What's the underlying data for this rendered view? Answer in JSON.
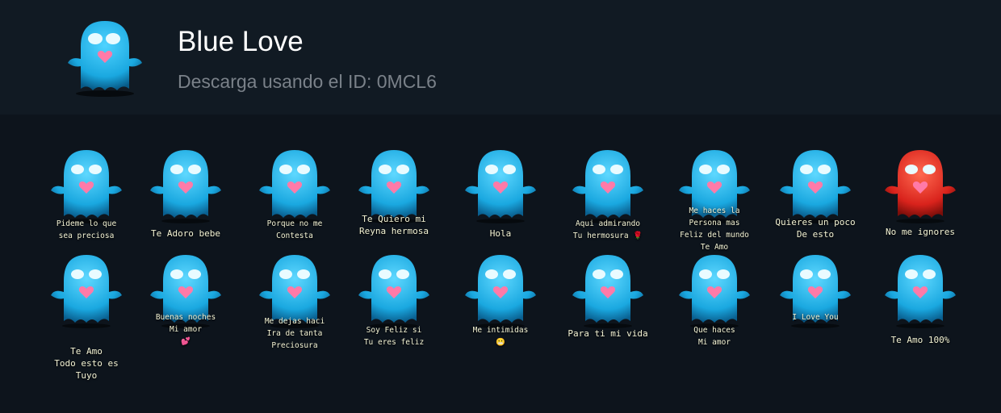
{
  "pack": {
    "title": "Blue Love",
    "subtitle": "Descarga usando el ID: 0MCL6"
  },
  "stickers": [
    {
      "caption": "Pideme lo que\nsea preciosa"
    },
    {
      "caption": "Te Adoro bebe"
    },
    {
      "caption": "Porque no me\nContesta"
    },
    {
      "caption": "Te Quiero mi\nReyna hermosa"
    },
    {
      "caption": "Hola"
    },
    {
      "caption": "Aqui admirando\nTu hermosura 🌹"
    },
    {
      "caption": "Me haces la\nPersona mas\nFeliz del mundo\nTe Amo"
    },
    {
      "caption": "Quieres un poco\nDe esto"
    },
    {
      "caption": "No me ignores"
    },
    {
      "caption": "Te Amo\nTodo esto es\nTuyo"
    },
    {
      "caption": "Buenas noches\nMi amor\n💕"
    },
    {
      "caption": "Me dejas haci\nIra de tanta\nPreciosura"
    },
    {
      "caption": "Soy Feliz si\nTu eres feliz"
    },
    {
      "caption": "Me intimidas\n😬"
    },
    {
      "caption": "Para ti mi vida"
    },
    {
      "caption": "Que haces\nMi amor"
    },
    {
      "caption": "I Love You"
    },
    {
      "caption": "Te Amo 100%"
    }
  ],
  "colors": {
    "ghost": "#1aa8e0",
    "ghost_dark": "#0a5f8f",
    "red_ghost": "#d9231c",
    "heart": "#ff7aa8",
    "eyes": "#e9fbff"
  }
}
